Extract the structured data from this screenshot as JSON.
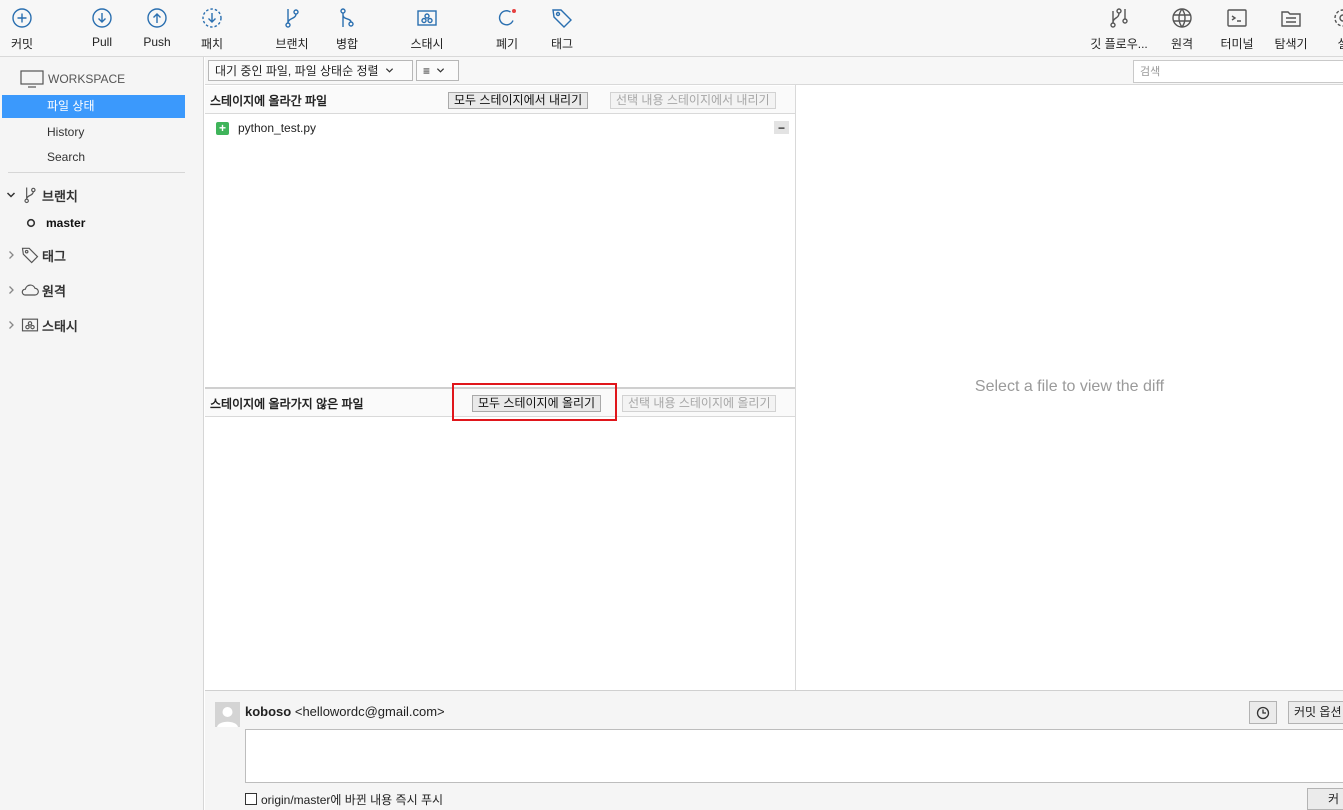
{
  "toolbar": {
    "commit": "커밋",
    "pull": "Pull",
    "push": "Push",
    "patch": "패치",
    "branch": "브랜치",
    "merge": "병합",
    "stash": "스태시",
    "discard": "폐기",
    "tag": "태그",
    "git_flow": "깃 플로우...",
    "remote": "원격",
    "terminal": "터미널",
    "explorer": "탐색기",
    "settings": "설"
  },
  "sidebar": {
    "workspace_title": "WORKSPACE",
    "items": [
      "파일 상태",
      "History",
      "Search"
    ],
    "branches_label": "브랜치",
    "current_branch": "master",
    "tags_label": "태그",
    "remotes_label": "원격",
    "stashes_label": "스태시"
  },
  "filter": {
    "mode": "대기 중인 파일, 파일 상태순 정렬",
    "view_icon": "≡",
    "search_placeholder": "검색"
  },
  "staged": {
    "title": "스테이지에 올라간 파일",
    "unstage_all": "모두 스테이지에서 내리기",
    "unstage_selected": "선택 내용 스테이지에서 내리기",
    "files": [
      "python_test.py"
    ]
  },
  "unstaged": {
    "title": "스테이지에 올라가지 않은 파일",
    "stage_all": "모두 스테이지에 올리기",
    "stage_selected": "선택 내용 스테이지에 올리기"
  },
  "diff": {
    "empty_message": "Select a file to view the diff"
  },
  "commit": {
    "author_name": "koboso",
    "author_email": "<hellowordc@gmail.com>",
    "options_label": "커밋 옵션",
    "push_label": "origin/master에 바뀐 내용 즉시 푸시",
    "commit_button": "커"
  },
  "colors": {
    "accent": "#3b99fc",
    "highlight": "#e0161b",
    "added": "#3fb45a",
    "icon": "#2a6fb0"
  }
}
